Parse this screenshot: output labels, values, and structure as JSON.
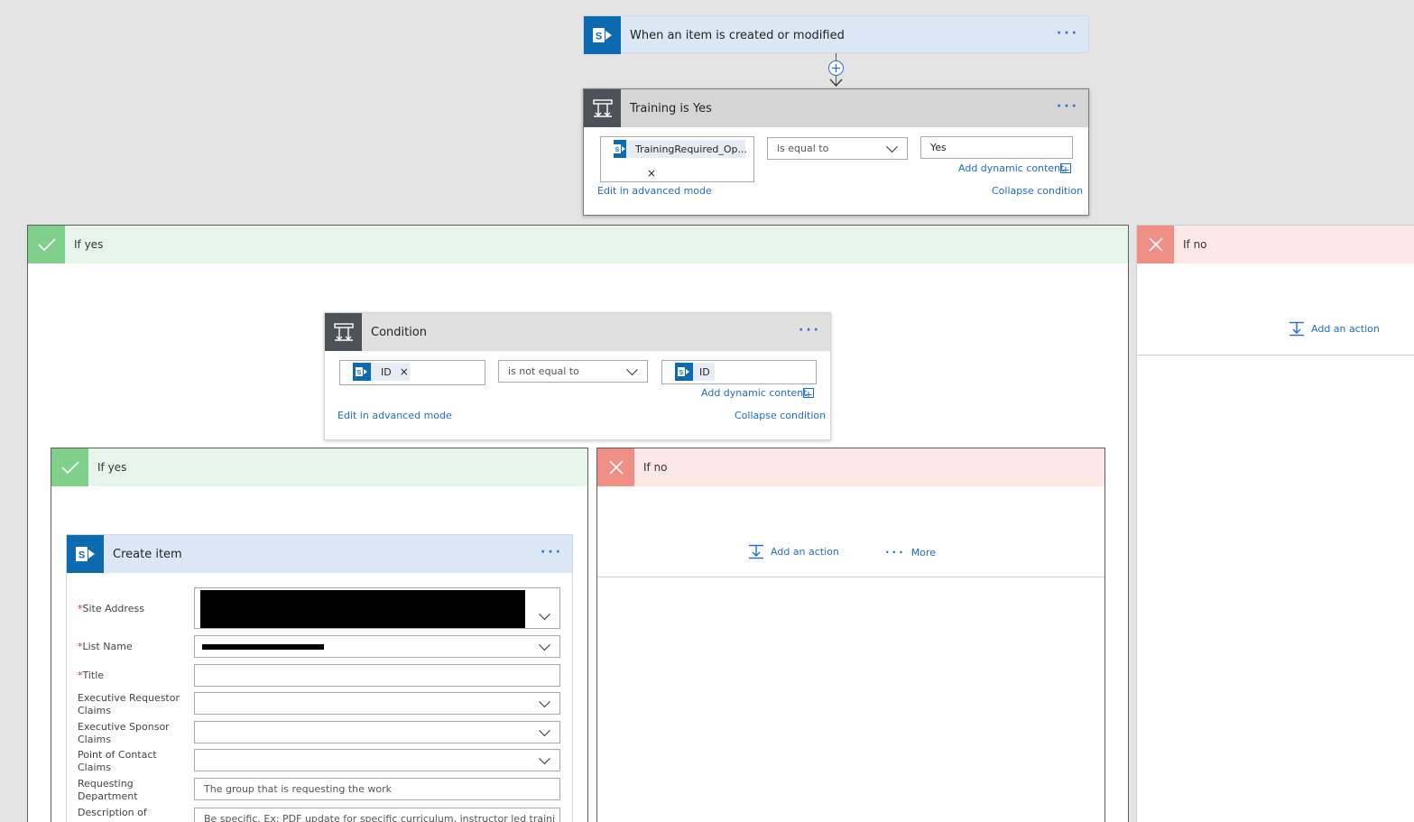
{
  "trigger": {
    "title": "When an item is created or modified",
    "menu": "···"
  },
  "condition1": {
    "title": "Training is Yes",
    "menu": "···",
    "token_label": "TrainingRequired_Op...",
    "token_remove": "×",
    "operator": "is equal to",
    "value": "Yes",
    "add_dynamic": "Add dynamic content",
    "edit_advanced": "Edit in advanced mode",
    "collapse": "Collapse condition"
  },
  "outer_yes": {
    "label": "If yes"
  },
  "outer_no": {
    "label": "If no",
    "add_action": "Add an action"
  },
  "condition2": {
    "title": "Condition",
    "menu": "···",
    "left_token": "ID",
    "left_remove": "×",
    "operator": "is not equal to",
    "right_token": "ID",
    "add_dynamic": "Add dynamic content",
    "edit_advanced": "Edit in advanced mode",
    "collapse": "Collapse condition"
  },
  "inner_yes": {
    "label": "If yes"
  },
  "inner_no": {
    "label": "If no",
    "add_action": "Add an action",
    "more": "More"
  },
  "create_item": {
    "title": "Create item",
    "menu": "···",
    "fields": {
      "site_address": "Site Address",
      "list_name": "List Name",
      "title": "Title",
      "exec_requestor_1": "Executive Requestor",
      "exec_requestor_2": "Claims",
      "exec_sponsor_1": "Executive Sponsor",
      "exec_sponsor_2": "Claims",
      "poc_1": "Point of Contact",
      "poc_2": "Claims",
      "req_dept_1": "Requesting",
      "req_dept_2": "Department",
      "desc_1": "Description of"
    },
    "required_mark": "*",
    "req_dept_placeholder": "The group that is requesting the work",
    "desc_placeholder": "Be specific. Ex: PDF update for specific curriculum, instructor led training to te"
  },
  "colors": {
    "sharepoint_blue": "#0b6ab0",
    "link_blue": "#1f6ccf",
    "yes_green": "#7ed08b",
    "no_red": "#f08f86"
  }
}
